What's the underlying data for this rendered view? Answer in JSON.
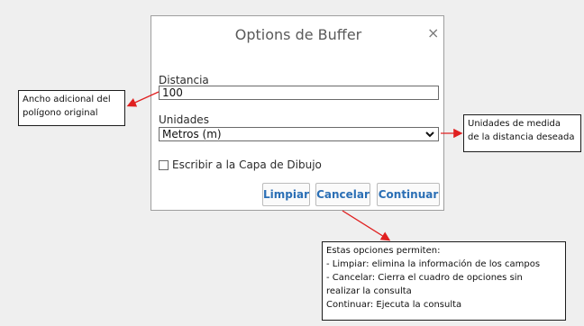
{
  "dialog": {
    "title": "Options de Buffer",
    "close_glyph": "×",
    "distancia_label": "Distancia",
    "distancia_value": "100",
    "unidades_label": "Unidades",
    "unidades_value": "Metros (m)",
    "checkbox_label": "Escribir a la Capa de Dibujo",
    "checkbox_checked": false,
    "buttons": {
      "limpiar": "Limpiar",
      "cancelar": "Cancelar",
      "continuar": "Continuar"
    }
  },
  "annotations": {
    "ancho": [
      "Ancho adicional del",
      "polígono original"
    ],
    "unidades": [
      "Unidades de medida",
      "de la distancia deseada"
    ],
    "opciones": [
      "Estas opciones permiten:",
      "- Limpiar: elimina la información de los campos",
      "- Cancelar: Cierra el cuadro de opciones sin",
      "realizar la consulta",
      "Continuar: Ejecuta la consulta"
    ]
  },
  "colors": {
    "accent_text": "#2b6fb5",
    "arrow": "#e02020"
  },
  "icons": {
    "close": "close-icon",
    "dropdown": "chevron-down-icon",
    "checkbox": "checkbox-icon"
  }
}
